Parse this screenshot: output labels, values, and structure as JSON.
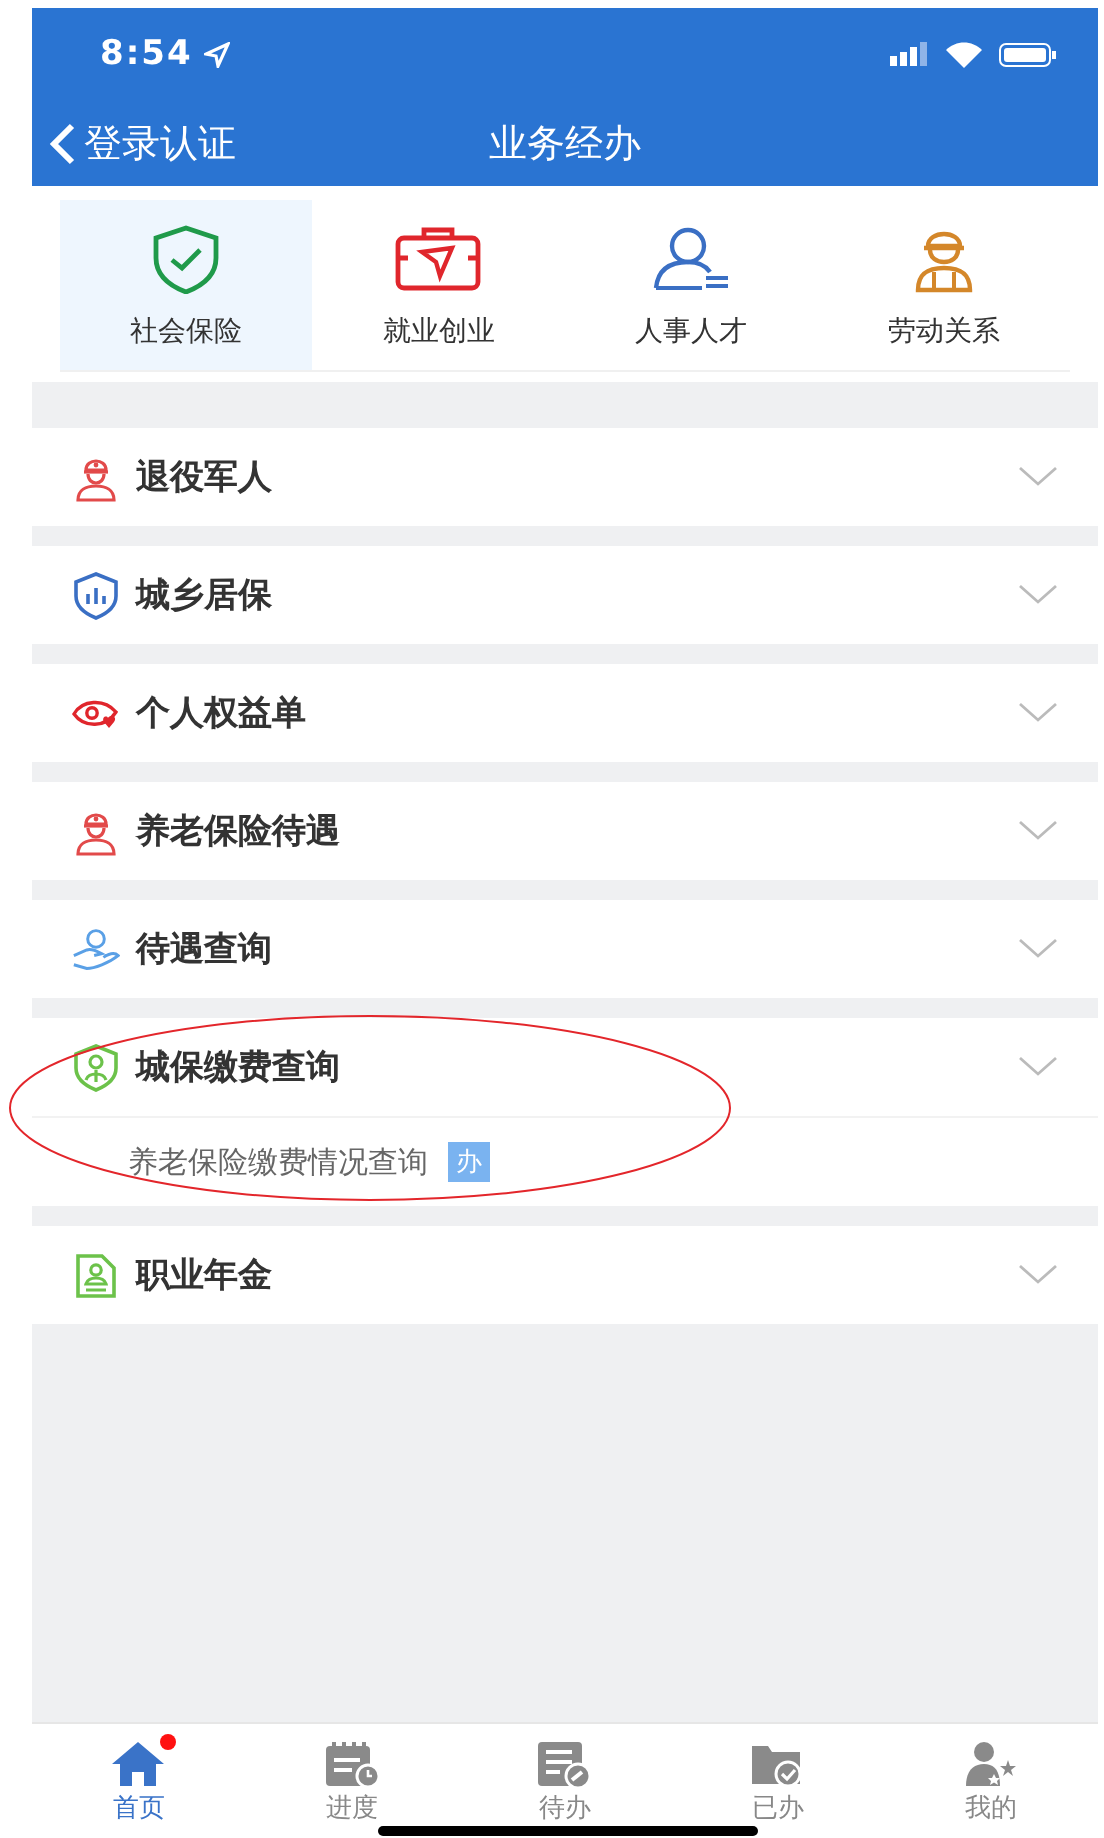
{
  "status_bar": {
    "time": "8:54"
  },
  "nav_bar": {
    "back_label": "登录认证",
    "title": "业务经办"
  },
  "categories": [
    {
      "label": "社会保险",
      "selected": true,
      "kind": "shield"
    },
    {
      "label": "就业创业",
      "selected": false,
      "kind": "briefcase"
    },
    {
      "label": "人事人才",
      "selected": false,
      "kind": "person"
    },
    {
      "label": "劳动关系",
      "selected": false,
      "kind": "worker"
    }
  ],
  "sections": [
    {
      "label": "退役军人",
      "kind": "soldier"
    },
    {
      "label": "城乡居保",
      "kind": "chart-shield"
    },
    {
      "label": "个人权益单",
      "kind": "eye"
    },
    {
      "label": "养老保险待遇",
      "kind": "soldier"
    },
    {
      "label": "待遇查询",
      "kind": "hand"
    },
    {
      "label": "城保缴费查询",
      "kind": "badge",
      "children": [
        {
          "label": "养老保险缴费情况查询",
          "tag": "办"
        }
      ]
    },
    {
      "label": "职业年金",
      "kind": "certificate"
    }
  ],
  "tab_bar": [
    {
      "label": "首页",
      "selected": true,
      "badge": true,
      "kind": "home"
    },
    {
      "label": "进度",
      "selected": false,
      "badge": false,
      "kind": "calendar"
    },
    {
      "label": "待办",
      "selected": false,
      "badge": false,
      "kind": "document"
    },
    {
      "label": "已办",
      "selected": false,
      "badge": false,
      "kind": "folder"
    },
    {
      "label": "我的",
      "selected": false,
      "badge": false,
      "kind": "user"
    }
  ]
}
